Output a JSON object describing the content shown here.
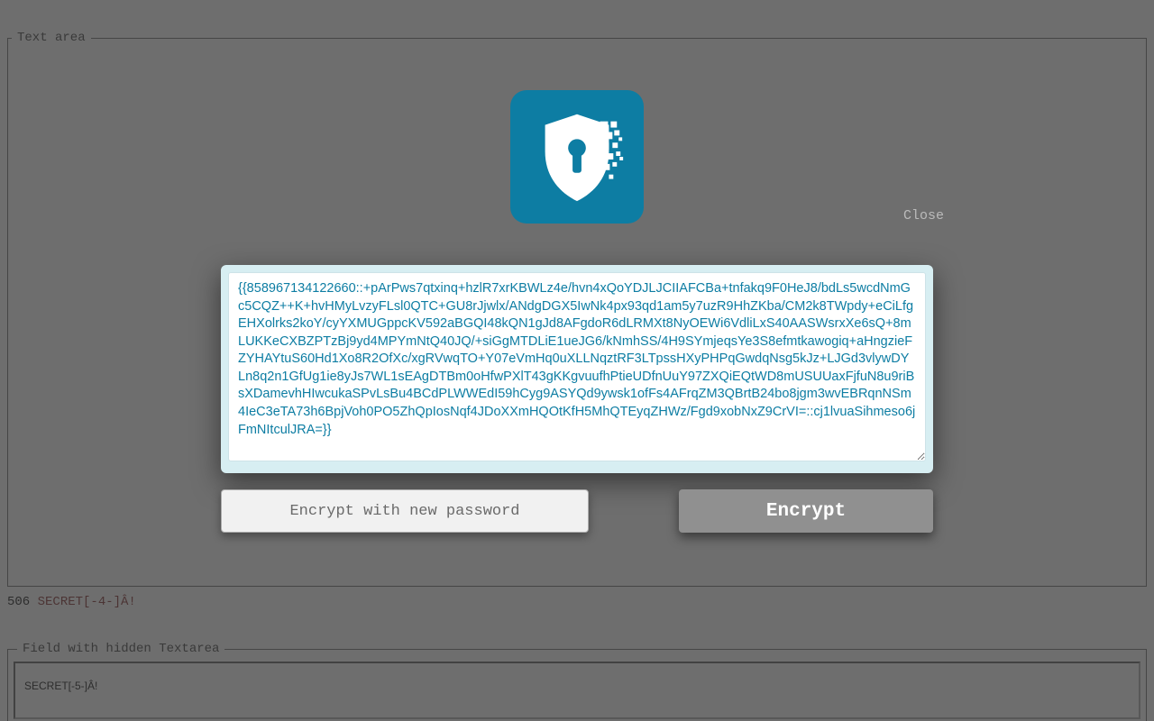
{
  "fieldset1": {
    "legend": "Text area"
  },
  "counter": {
    "number": "506",
    "secret": " SECRET[-4-]Â!"
  },
  "fieldset2": {
    "legend": "Field with hidden Textarea",
    "content": "SECRET[-5-]Â!"
  },
  "dialog": {
    "close": "Close",
    "cipher": "{{858967134122660::+pArPws7qtxinq+hzlR7xrKBWLz4e/hvn4xQoYDJLJCIIAFCBa+tnfakq9F0HeJ8/bdLs5wcdNmGc5CQZ++K+hvHMyLvzyFLsl0QTC+GU8rJjwlx/ANdgDGX5IwNk4px93qd1am5y7uzR9HhZKba/CM2k8TWpdy+eCiLfgEHXolrks2koY/cyYXMUGppcKV592aBGQI48kQN1gJd8AFgdoR6dLRMXt8NyOEWi6VdliLxS40AASWsrxXe6sQ+8mLUKKeCXBZPTzBj9yd4MPYmNtQ40JQ/+siGgMTDLiE1ueJG6/kNmhSS/4H9SYmjeqsYe3S8efmtkawogiq+aHngzieFZYHAYtuS60Hd1Xo8R2OfXc/xgRVwqTO+Y07eVmHq0uXLLNqztRF3LTpssHXyPHPqGwdqNsg5kJz+LJGd3vlywDYLn8q2n1GfUg1ie8yJs7WL1sEAgDTBm0oHfwPXlT43gKKgvuufhPtieUDfnUuY97ZXQiEQtWD8mUSUUaxFjfuN8u9riBsXDamevhHIwcukaSPvLsBu4BCdPLWWEdI59hCyg9ASYQd9ywsk1ofFs4AFrqZM3QBrtB24bo8jgm3wvEBRqnNSm4IeC3eTA73h6BpjVoh0PO5ZhQpIosNqf4JDoXXmHQOtKfH5MhQTEyqZHWz/Fgd9xobNxZ9CrVI=::cj1lvuaSihmeso6jFmNItculJRA=}}",
    "password_placeholder": "Encrypt with new password",
    "encrypt_label": "Encrypt"
  },
  "colors": {
    "brand": "#0d7da3"
  }
}
